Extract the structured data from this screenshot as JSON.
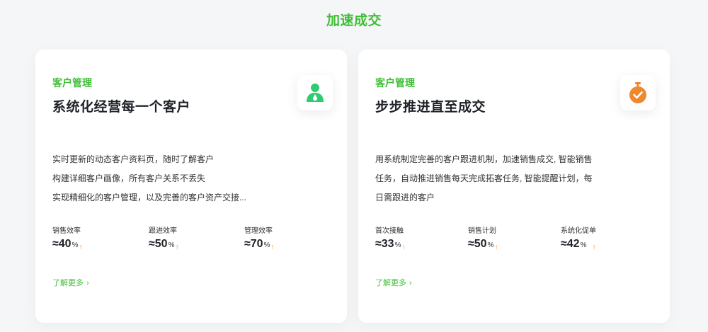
{
  "section": {
    "title": "加速成交"
  },
  "cards": [
    {
      "category": "客户管理",
      "headline": "系统化经营每一个客户",
      "icon": "customer-icon",
      "icon_color": "#2ecc71",
      "description": [
        "实时更新的动态客户资料页，随时了解客户",
        "构建详细客户画像，所有客户关系不丢失",
        "实现精细化的客户管理，以及完善的客户资产交接..."
      ],
      "stats": [
        {
          "label": "销售效率",
          "value": "≈40",
          "unit": "%",
          "arrow": "↑"
        },
        {
          "label": "跟进效率",
          "value": "≈50",
          "unit": "%",
          "arrow": "↑"
        },
        {
          "label": "管理效率",
          "value": "≈70",
          "unit": "%",
          "arrow": "↑"
        }
      ],
      "more_label": "了解更多",
      "more_chevron": "›"
    },
    {
      "category": "客户管理",
      "headline": "步步推进直至成交",
      "icon": "stopwatch-check-icon",
      "icon_color": "#f0882e",
      "description": [
        "用系统制定完善的客户跟进机制，加速销售成交, 智能销售",
        "任务，自动推进销售每天完成拓客任务, 智能提醒计划，每",
        "日需跟进的客户"
      ],
      "stats": [
        {
          "label": "首次接触",
          "value": "≈33",
          "unit": "%",
          "arrow": "↑"
        },
        {
          "label": "销售计划",
          "value": "≈50",
          "unit": "%",
          "arrow": "↑"
        },
        {
          "label": "系统化促单",
          "value": "≈42",
          "unit": "%",
          "arrow": "↑"
        }
      ],
      "more_label": "了解更多",
      "more_chevron": "›"
    }
  ],
  "colors": {
    "accent_green": "#3ebf36",
    "accent_orange": "#f0882e",
    "background": "#f5f6f7",
    "card": "#ffffff"
  }
}
